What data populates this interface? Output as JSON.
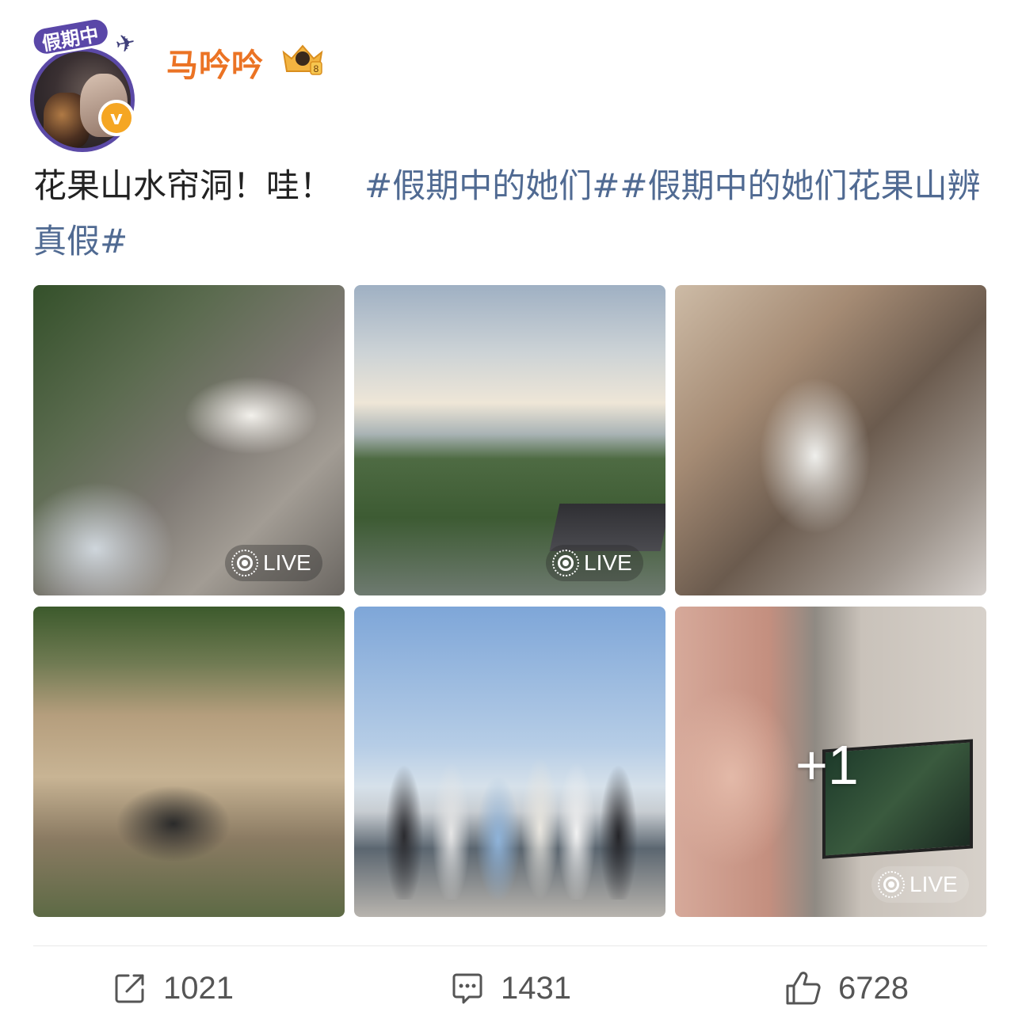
{
  "user": {
    "name": "马吟吟",
    "avatar_badge": "假期中",
    "verified_mark": "v",
    "vip_level": "8"
  },
  "post": {
    "text": "花果山水帘洞！哇！",
    "hashtags": "#假期中的她们##假期中的她们花果山辨真假#"
  },
  "media": {
    "live_label": "LIVE",
    "extra_count": "+1"
  },
  "actions": {
    "share_count": "1021",
    "comment_count": "1431",
    "like_count": "6728"
  },
  "colors": {
    "username": "#eb7324",
    "hashtag": "#506a92",
    "avatar_ring": "#5b49a6"
  }
}
